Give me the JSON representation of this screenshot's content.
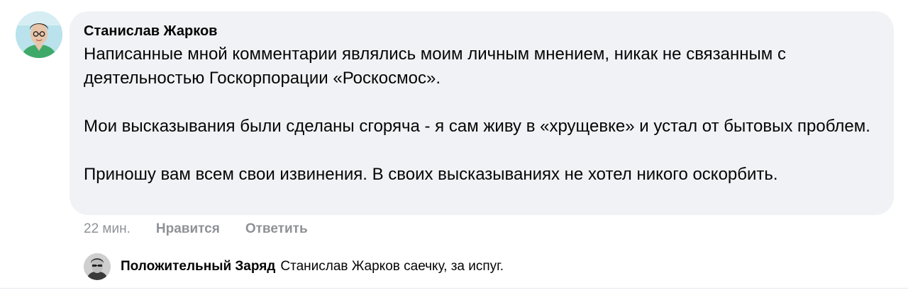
{
  "comment": {
    "author": "Станислав Жарков",
    "paragraphs": [
      "Написанные мной комментарии являлись моим личным мнением, никак не связанным с деятельностью Госкорпорации «Роскосмос».",
      "Мои высказывания были сделаны сгоряча - я сам живу в «хрущевке» и устал от бытовых проблем.",
      "Приношу вам всем свои извинения. В своих высказываниях не хотел никого оскорбить."
    ],
    "time": "22 мин.",
    "like_label": "Нравится",
    "reply_label": "Ответить"
  },
  "reply": {
    "author": "Положительный Заряд",
    "text": "Станислав Жарков саечку, за испуг."
  },
  "colors": {
    "bubble": "#f0f2f5",
    "meta_text": "#8e9297",
    "avatar_bg": "#b9e2ec"
  }
}
